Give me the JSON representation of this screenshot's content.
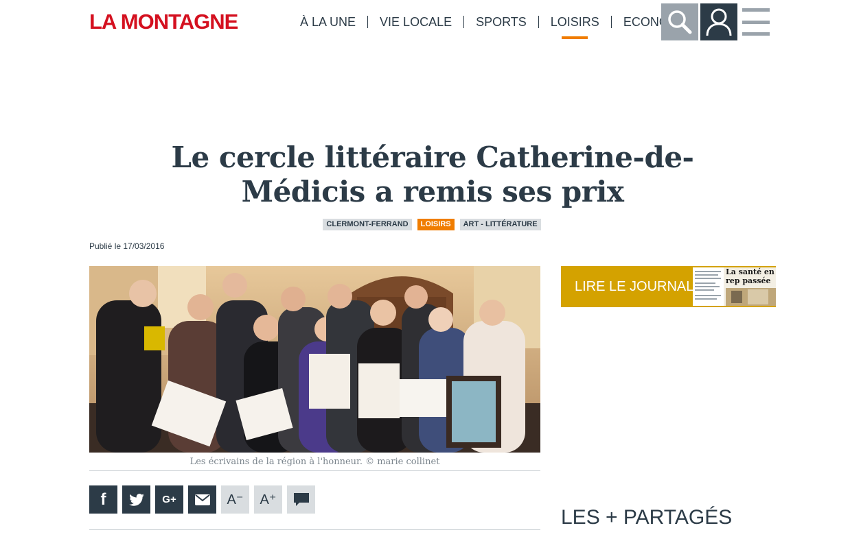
{
  "header": {
    "logo": "LA MONTAGNE",
    "nav": [
      {
        "label": "À LA UNE",
        "active": false
      },
      {
        "label": "VIE LOCALE",
        "active": false
      },
      {
        "label": "SPORTS",
        "active": false
      },
      {
        "label": "LOISIRS",
        "active": true
      },
      {
        "label": "ECONOMIE",
        "active": false
      }
    ],
    "search_icon": "search-icon",
    "user_icon": "user-icon",
    "menu_icon": "hamburger-icon"
  },
  "article": {
    "title": "Le cercle littéraire Catherine-de-Médicis a remis ses prix",
    "tags": [
      {
        "label": "CLERMONT-FERRAND",
        "style": "grey"
      },
      {
        "label": "LOISIRS",
        "style": "orange"
      },
      {
        "label": "ART - LITTÉRATURE",
        "style": "grey"
      }
    ],
    "published": "Publié le 17/03/2016",
    "caption": "Les écrivains de la région à l'honneur. © marie collinet"
  },
  "share": [
    {
      "name": "facebook-button",
      "icon": "facebook-icon",
      "text": "f"
    },
    {
      "name": "twitter-button",
      "icon": "twitter-icon",
      "text": ""
    },
    {
      "name": "googleplus-button",
      "icon": "googleplus-icon",
      "text": "G+"
    },
    {
      "name": "email-button",
      "icon": "envelope-icon",
      "text": ""
    },
    {
      "name": "font-decrease-button",
      "icon": "font-decrease-icon",
      "text": "A⁻"
    },
    {
      "name": "font-increase-button",
      "icon": "font-increase-icon",
      "text": "A⁺"
    },
    {
      "name": "comment-button",
      "icon": "comment-icon",
      "text": ""
    }
  ],
  "sidebar": {
    "journal_label": "LIRE LE JOURNAL",
    "journal_headline": "La santé en rep passée au scan",
    "partages_title": "LES + PARTAGÉS"
  },
  "colors": {
    "logo": "#d4101f",
    "accent": "#f07d00",
    "text": "#2c3b47",
    "journal": "#d4a200"
  }
}
